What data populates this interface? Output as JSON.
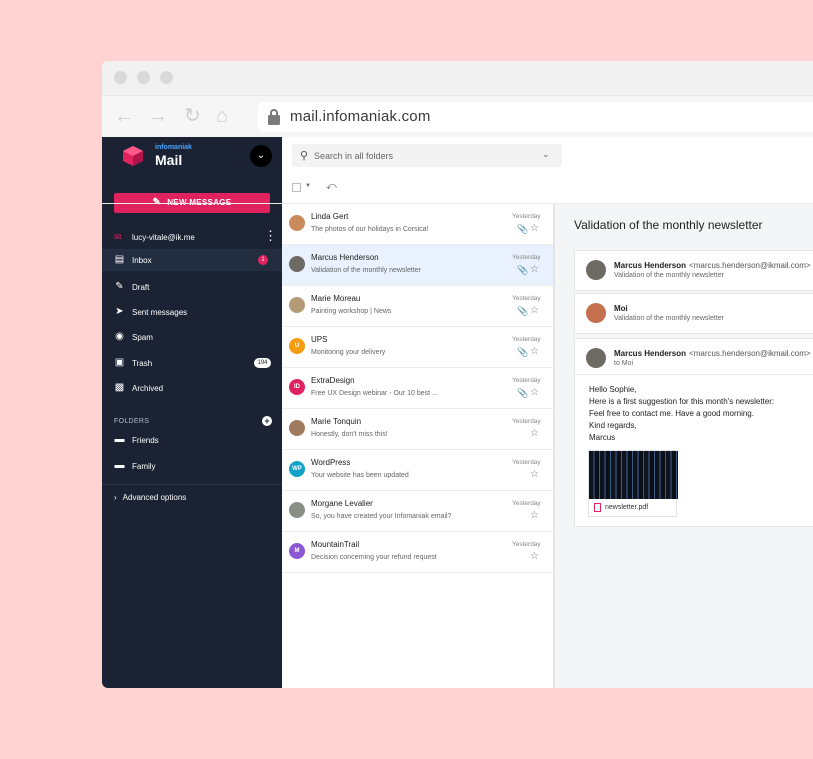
{
  "browser": {
    "url": "mail.infomaniak.com",
    "icons": {
      "back": "←",
      "forward": "→",
      "reload": "↻",
      "home": "⌂"
    }
  },
  "sidebar": {
    "brand_small": "infomaniak",
    "brand_big": "Mail",
    "new_message_label": "NEW MESSAGE",
    "account_email": "lucy-vitale@ik.me",
    "items": [
      {
        "label": "Inbox",
        "icon": "inbox-icon",
        "badge": "1"
      },
      {
        "label": "Draft",
        "icon": "draft-icon"
      },
      {
        "label": "Sent messages",
        "icon": "send-icon"
      },
      {
        "label": "Spam",
        "icon": "spam-icon"
      },
      {
        "label": "Trash",
        "icon": "trash-icon",
        "badge": "194"
      },
      {
        "label": "Archived",
        "icon": "archive-icon"
      }
    ],
    "folders_title": "FOLDERS",
    "folders": [
      {
        "label": "Friends"
      },
      {
        "label": "Family"
      }
    ],
    "advanced_options": "Advanced options"
  },
  "search": {
    "placeholder": "Search in all folders"
  },
  "messages": [
    {
      "sender": "Linda Gert",
      "subject": "The photos of our holidays in Corsica!",
      "date": "Yesterday",
      "attachment": true,
      "avatar_color": "#c98b5b",
      "initials": ""
    },
    {
      "sender": "Marcus Henderson",
      "subject": "Validation of the monthly newsletter",
      "date": "Yesterday",
      "attachment": true,
      "avatar_color": "#6e6a64",
      "initials": ""
    },
    {
      "sender": "Marie Moreau",
      "subject": "Painting workshop | News",
      "date": "Yesterday",
      "attachment": true,
      "avatar_color": "#b59a77",
      "initials": ""
    },
    {
      "sender": "UPS",
      "subject": "Monitoring your delivery",
      "date": "Yesterday",
      "attachment": true,
      "avatar_color": "#f59d0e",
      "initials": "U"
    },
    {
      "sender": "ExtraDesign",
      "subject": "Free UX Design webinar - Our 10 best ...",
      "date": "Yesterday",
      "attachment": true,
      "avatar_color": "#e0225e",
      "initials": "ID"
    },
    {
      "sender": "Marie Tonquin",
      "subject": "Honestly, don't miss this!",
      "date": "Yesterday",
      "attachment": false,
      "avatar_color": "#a07a5d",
      "initials": ""
    },
    {
      "sender": "WordPress",
      "subject": "Your website has been updated",
      "date": "Yesterday",
      "attachment": false,
      "avatar_color": "#14a3c7",
      "initials": "WP"
    },
    {
      "sender": "Morgane Levalier",
      "subject": "So, you have created your Infomaniak email?",
      "date": "Yesterday",
      "attachment": false,
      "avatar_color": "#8a8f86",
      "initials": ""
    },
    {
      "sender": "MountainTrail",
      "subject": "Decision concerning your refund request",
      "date": "Yesterday",
      "attachment": false,
      "avatar_color": "#8e57d6",
      "initials": "M"
    }
  ],
  "reading": {
    "title": "Validation of the monthly newsletter",
    "thread": [
      {
        "sender": "Marcus Henderson",
        "email": "<marcus.henderson@ikmail.com>",
        "line": "Validation of the monthly newsletter",
        "avatar_color": "#6e6a64"
      },
      {
        "sender": "Moi",
        "email": "",
        "line": "Validation of the monthly newsletter",
        "avatar_color": "#c4704e"
      },
      {
        "sender": "Marcus Henderson",
        "email": "<marcus.henderson@ikmail.com>",
        "line": "to Moi",
        "avatar_color": "#6e6a64"
      }
    ],
    "body": [
      "Hello Sophie,",
      "Here is a first suggestion for this month's newsletter:",
      "Feel free to contact me. Have a good morning.",
      "Kind regards,",
      "Marcus"
    ],
    "attachment_name": "newsletter.pdf"
  },
  "colors": {
    "accent": "#e0225e",
    "sidebar_bg": "#1a2233",
    "selected_row": "#e8f1fd",
    "background": "#ffd3d1"
  }
}
